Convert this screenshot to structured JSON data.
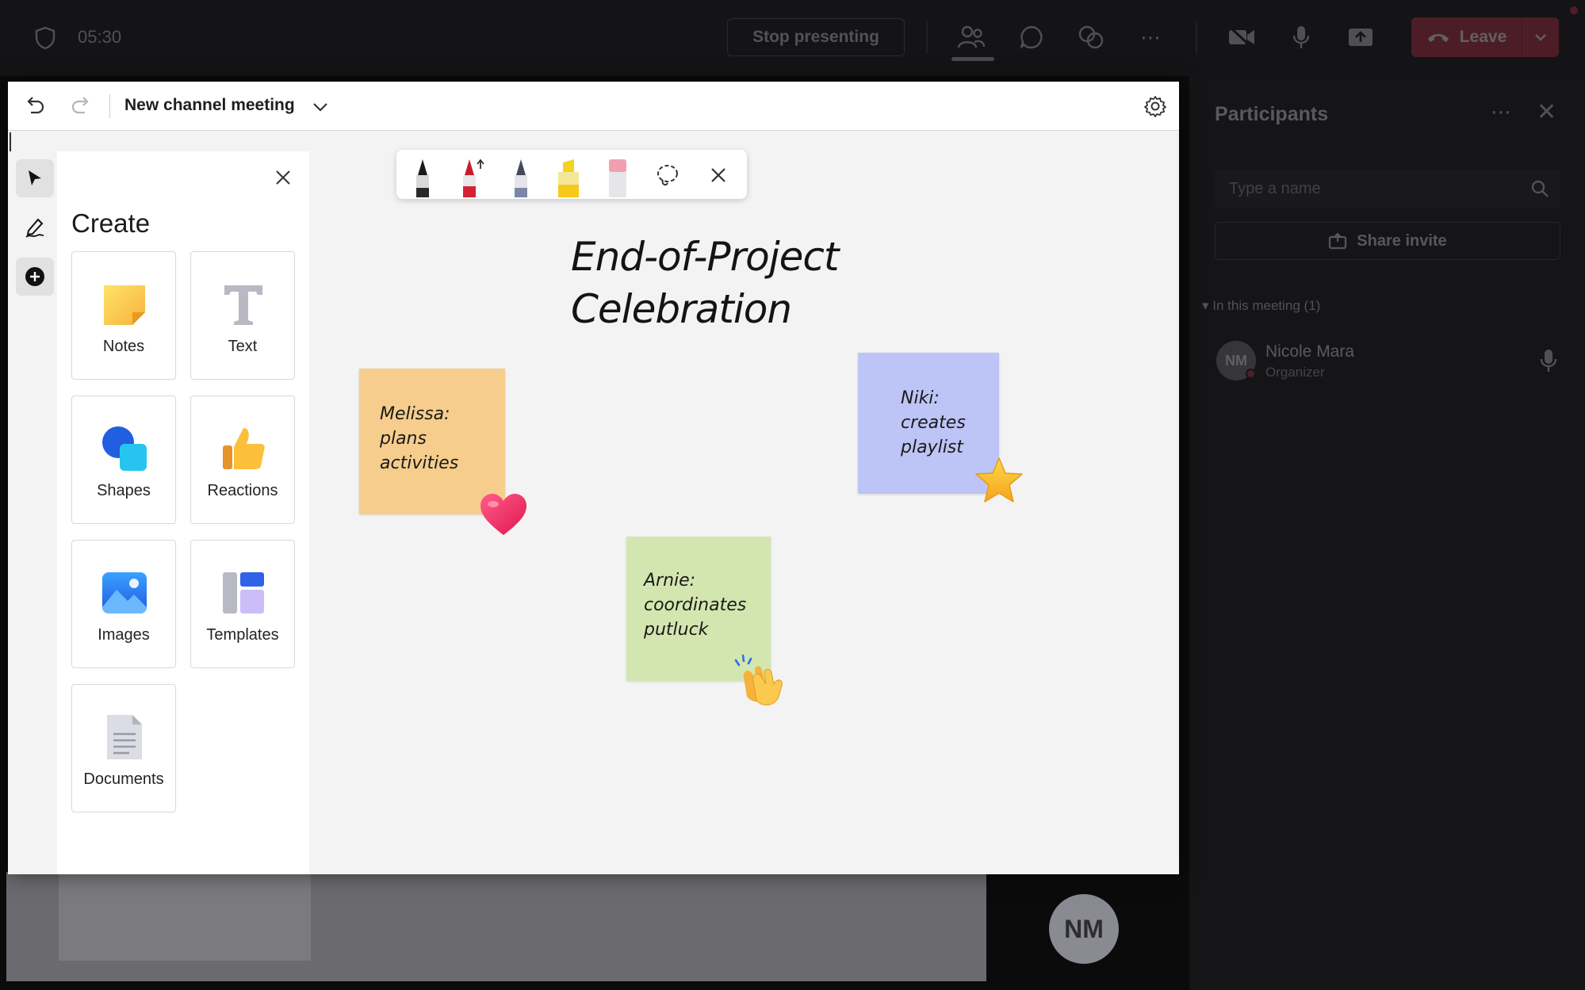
{
  "topbar": {
    "timer": "05:30",
    "stop_presenting": "Stop presenting",
    "leave": "Leave"
  },
  "participants": {
    "title": "Participants",
    "search_placeholder": "Type a name",
    "share_invite": "Share invite",
    "section": "In this meeting (1)",
    "people": [
      {
        "initials": "NM",
        "name": "Nicole Mara",
        "role": "Organizer"
      }
    ]
  },
  "stage": {
    "avatar_initials": "NM"
  },
  "whiteboard": {
    "title": "New channel meeting",
    "board_title_line1": "End-of-Project",
    "board_title_line2": "Celebration",
    "create_panel": {
      "title": "Create",
      "tiles": [
        "Notes",
        "Text",
        "Shapes",
        "Reactions",
        "Images",
        "Templates",
        "Documents"
      ]
    },
    "notes": [
      {
        "lines": [
          "Melissa:",
          "plans",
          "activities"
        ],
        "color": "#f6cd8c",
        "reaction": "heart-icon"
      },
      {
        "lines": [
          "Niki:",
          "creates",
          "playlist"
        ],
        "color": "#bdc4f6",
        "reaction": "star-icon"
      },
      {
        "lines": [
          "Arnie:",
          "coordinates",
          "putluck"
        ],
        "color": "#d4e6b0",
        "reaction": "clapping-hands-icon"
      }
    ],
    "ink_tools": [
      "black-pen-icon",
      "red-pen-icon",
      "blue-pen-icon",
      "yellow-highlighter-icon",
      "eraser-icon",
      "lasso-icon",
      "close-icon"
    ]
  },
  "colors": {
    "leave_red": "#c4314b",
    "note_yellow": "#f6cd8c",
    "note_blue": "#bdc4f6",
    "note_green": "#d4e6b0"
  }
}
